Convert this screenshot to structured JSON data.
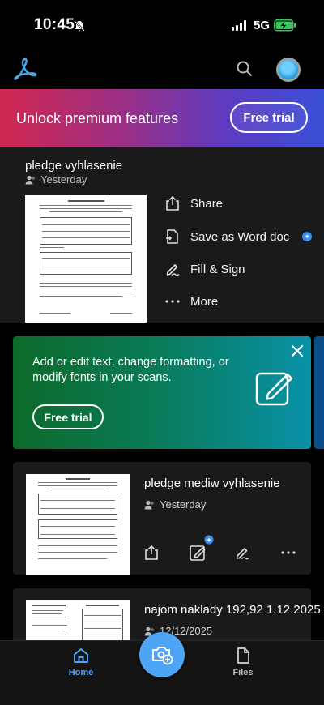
{
  "status_bar": {
    "time": "10:45",
    "network": "5G"
  },
  "header": {
    "logo": "adobe-acrobat-logo",
    "search_icon": "search-icon"
  },
  "premium_banner": {
    "text": "Unlock premium features",
    "button": "Free trial"
  },
  "recent_doc": {
    "title": "pledge vyhlasenie",
    "date": "Yesterday",
    "actions": [
      {
        "label": "Share",
        "icon": "share-icon"
      },
      {
        "label": "Save as Word doc",
        "icon": "word-export-icon",
        "premium": true
      },
      {
        "label": "Fill & Sign",
        "icon": "fill-sign-icon"
      },
      {
        "label": "More",
        "icon": "more-icon"
      }
    ]
  },
  "promo": {
    "text": "Add or edit text, change formatting, or modify fonts in your scans.",
    "button": "Free trial"
  },
  "documents": [
    {
      "title": "pledge mediw vyhlasenie",
      "date": "Yesterday"
    },
    {
      "title": "najom naklady 192,92 1.12.2025",
      "date": "12/12/2025"
    }
  ],
  "bottom_nav": {
    "home": "Home",
    "files": "Files"
  },
  "colors": {
    "accent": "#4ea4f5",
    "badge": "#3a8ef6",
    "card": "#1a1a1a"
  }
}
